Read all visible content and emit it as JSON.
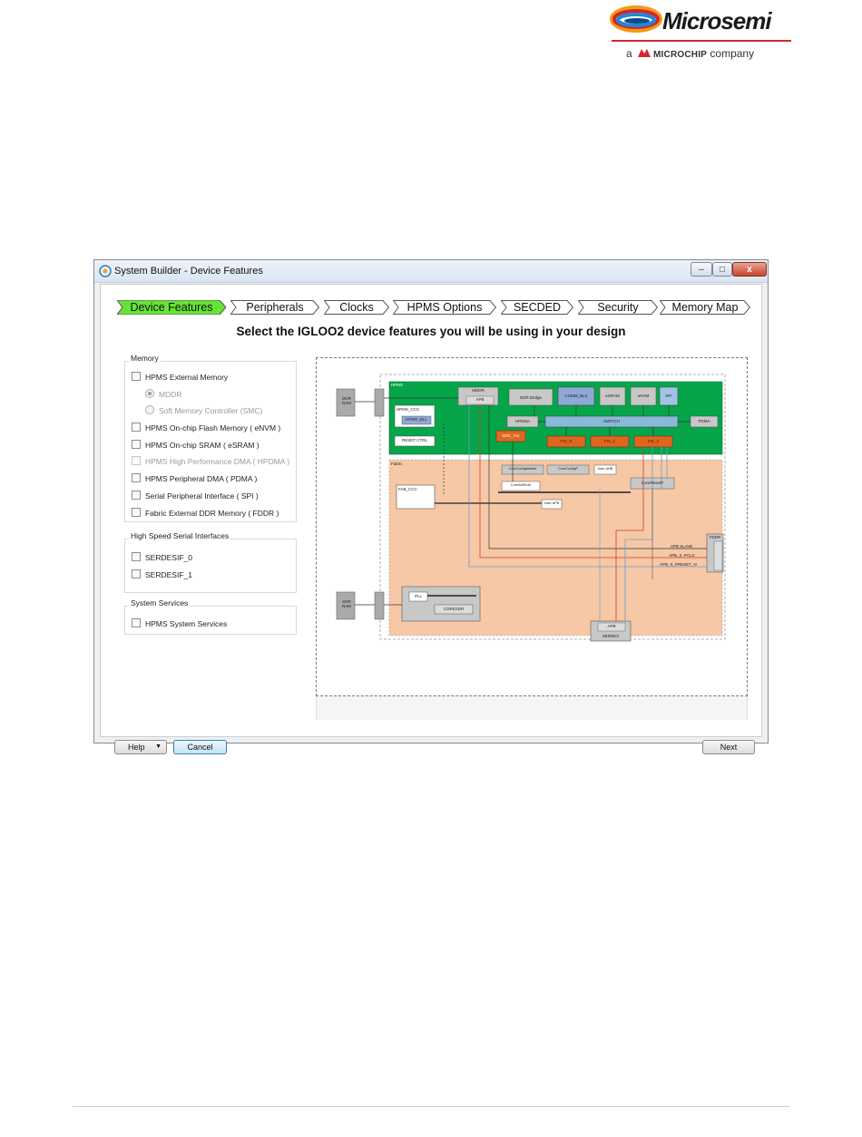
{
  "logo": {
    "brand": "Microsemi",
    "tag_prefix": "a",
    "tag_brand": "MICROCHIP",
    "tag_suffix": "company"
  },
  "window": {
    "title": "System Builder - Device Features",
    "controls": {
      "minimize": "–",
      "maximize": "□",
      "close": "x"
    }
  },
  "wizard": {
    "steps": [
      {
        "label": "Device Features",
        "active": true
      },
      {
        "label": "Peripherals",
        "active": false
      },
      {
        "label": "Clocks",
        "active": false
      },
      {
        "label": "HPMS Options",
        "active": false
      },
      {
        "label": "SECDED",
        "active": false
      },
      {
        "label": "Security",
        "active": false
      },
      {
        "label": "Memory Map",
        "active": false
      }
    ],
    "heading": "Select the IGLOO2 device features you will be using in your design"
  },
  "groups": {
    "memory": {
      "title": "Memory",
      "items": [
        "HPMS External Memory",
        "MDDR",
        "Soft Memory Controller (SMC)",
        "HPMS On-chip Flash Memory ( eNVM )",
        "HPMS On-chip SRAM ( eSRAM )",
        "HPMS High Performance DMA ( HPDMA )",
        "HPMS Peripheral DMA ( PDMA )",
        "Serial Peripheral Interface ( SPI )",
        "Fabric External DDR Memory ( FDDR )"
      ]
    },
    "serial": {
      "title": "High Speed Serial Interfaces",
      "items": [
        "SERDESIF_0",
        "SERDESIF_1"
      ]
    },
    "services": {
      "title": "System Services",
      "items": [
        "HPMS System Services"
      ]
    }
  },
  "diagram": {
    "hpms_label": "HPMS",
    "fabric_label": "Fabric",
    "ddr_ram": "DDR RAM",
    "sdr_ram": "SDR RAM",
    "mddr": "MDDR",
    "apb": "APB",
    "ddr_bridge": "DDR Bridge",
    "comm_blk": "COMM_BLK",
    "esram": "eSRAM",
    "envm": "eNVM",
    "spi": "SPI",
    "hpms_ccc": "HPMS_CCC",
    "hpms_dll": "HPMS_DLL",
    "reset_ctrl": "RESET CTRL",
    "hpdma": "HPDMA",
    "switch": "SWITCH",
    "pdma": "PDMA",
    "smc_fic": "SMC_FIC",
    "fic_0": "FIC_0",
    "fic_1": "FIC_1",
    "fic_2": "FIC_2",
    "fab_ccc": "FAB_CCC",
    "core_reset": "CoreResetP",
    "coreconfig": "CoreConfigMaster",
    "coreconfig2": "CoreConfigP",
    "user_ahb": "User AHB",
    "coreahblite": "CoreAHBLite",
    "user_apb": "User APB",
    "fddr": "FDDR",
    "pll": "PLL",
    "coresdr": "CORESDR",
    "serdes": "SERDES",
    "apb_slave": "APB SLAVE",
    "apb_s_pclk": "APB_S_PCLK",
    "apb_s_preset": "APB_S_PRESET_N"
  },
  "buttons": {
    "help": "Help",
    "cancel": "Cancel",
    "next": "Next"
  },
  "colors": {
    "tab_active": "#66e436",
    "hpms_green": "#06a54a",
    "fabric_peach": "#f6c8a6",
    "fic_orange": "#e0661f",
    "switch_blue": "#8ab9d8"
  }
}
